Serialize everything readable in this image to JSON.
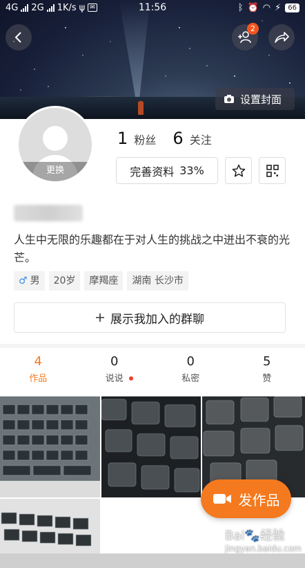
{
  "status_bar": {
    "network_1": "4G",
    "network_2": "2G",
    "speed": "1K/s",
    "time": "11:56",
    "battery": "66"
  },
  "header": {
    "friend_badge": "2",
    "cover_button": "设置封面"
  },
  "profile": {
    "avatar_change": "更换",
    "fans_count": "1",
    "fans_label": "粉丝",
    "following_count": "6",
    "following_label": "关注",
    "complete_profile": "完善资料",
    "complete_percent": "33%",
    "bio": "人生中无限的乐趣都在于对人生的挑战之中迸出不衰的光芒。",
    "tags": {
      "gender_symbol": "♂",
      "gender": "男",
      "age": "20岁",
      "zodiac": "摩羯座",
      "location": "湖南 长沙市"
    },
    "groups_button": "展示我加入的群聊"
  },
  "tabs": [
    {
      "count": "4",
      "label": "作品"
    },
    {
      "count": "0",
      "label": "说说"
    },
    {
      "count": "0",
      "label": "私密"
    },
    {
      "count": "5",
      "label": "赞"
    }
  ],
  "publish_button": "发作品",
  "watermark": {
    "brand": "Bai",
    "brand_mid": "经验",
    "url": "jingyan.baidu.com"
  },
  "colors": {
    "accent": "#f5791e",
    "badge": "#f4551f",
    "male": "#3d8ce4",
    "dot": "#f03c2e"
  },
  "icons": [
    "back-arrow-icon",
    "add-friend-icon",
    "share-icon",
    "camera-icon",
    "star-icon",
    "qrcode-icon",
    "plus-icon",
    "video-camera-icon"
  ]
}
